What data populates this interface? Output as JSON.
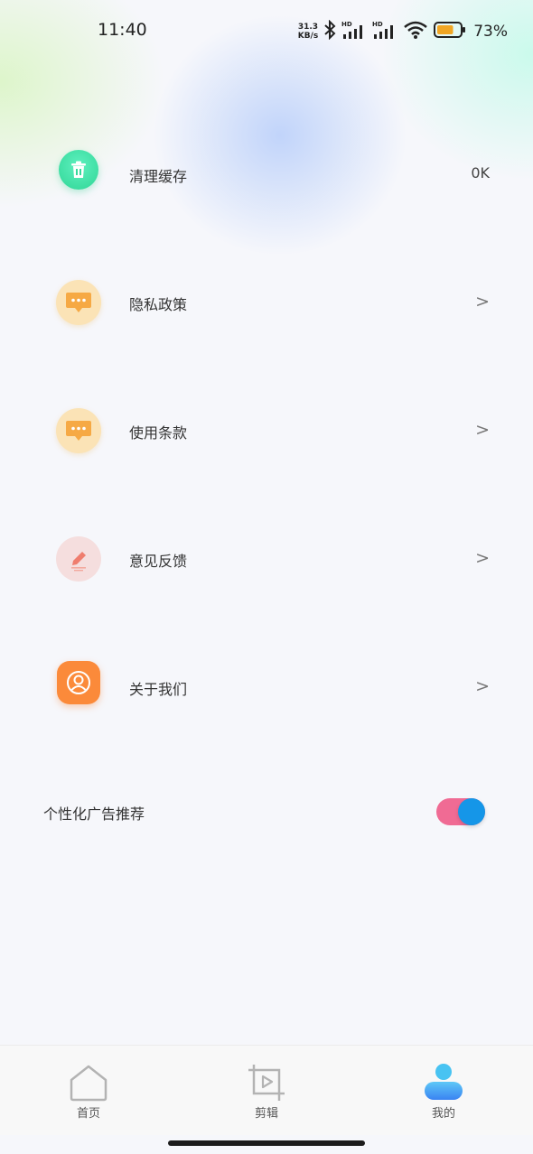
{
  "status_bar": {
    "time": "11:40",
    "net_speed_value": "31.3",
    "net_speed_unit": "KB/s",
    "battery_percent": "73%",
    "battery_level": 0.73,
    "battery_color": "#f1a623"
  },
  "menu": {
    "items": [
      {
        "label": "清理缓存",
        "value": "0K",
        "icon": "trash-icon",
        "color": "#3fe0a4"
      },
      {
        "label": "隐私政策",
        "chevron": ">",
        "icon": "chat-bubble-icon",
        "color": "#f6b04c"
      },
      {
        "label": "使用条款",
        "chevron": ">",
        "icon": "chat-bubble-icon",
        "color": "#f6b04c"
      },
      {
        "label": "意见反馈",
        "chevron": ">",
        "icon": "pen-icon",
        "color": "#ef7f6f"
      },
      {
        "label": "关于我们",
        "chevron": ">",
        "icon": "user-circle-icon",
        "color": "#fb8a3a"
      }
    ]
  },
  "ad_setting": {
    "label": "个性化广告推荐",
    "enabled": true
  },
  "tabbar": {
    "tabs": [
      {
        "label": "首页",
        "icon": "home-icon"
      },
      {
        "label": "剪辑",
        "icon": "crop-play-icon"
      },
      {
        "label": "我的",
        "icon": "user-icon",
        "active": true
      }
    ]
  }
}
